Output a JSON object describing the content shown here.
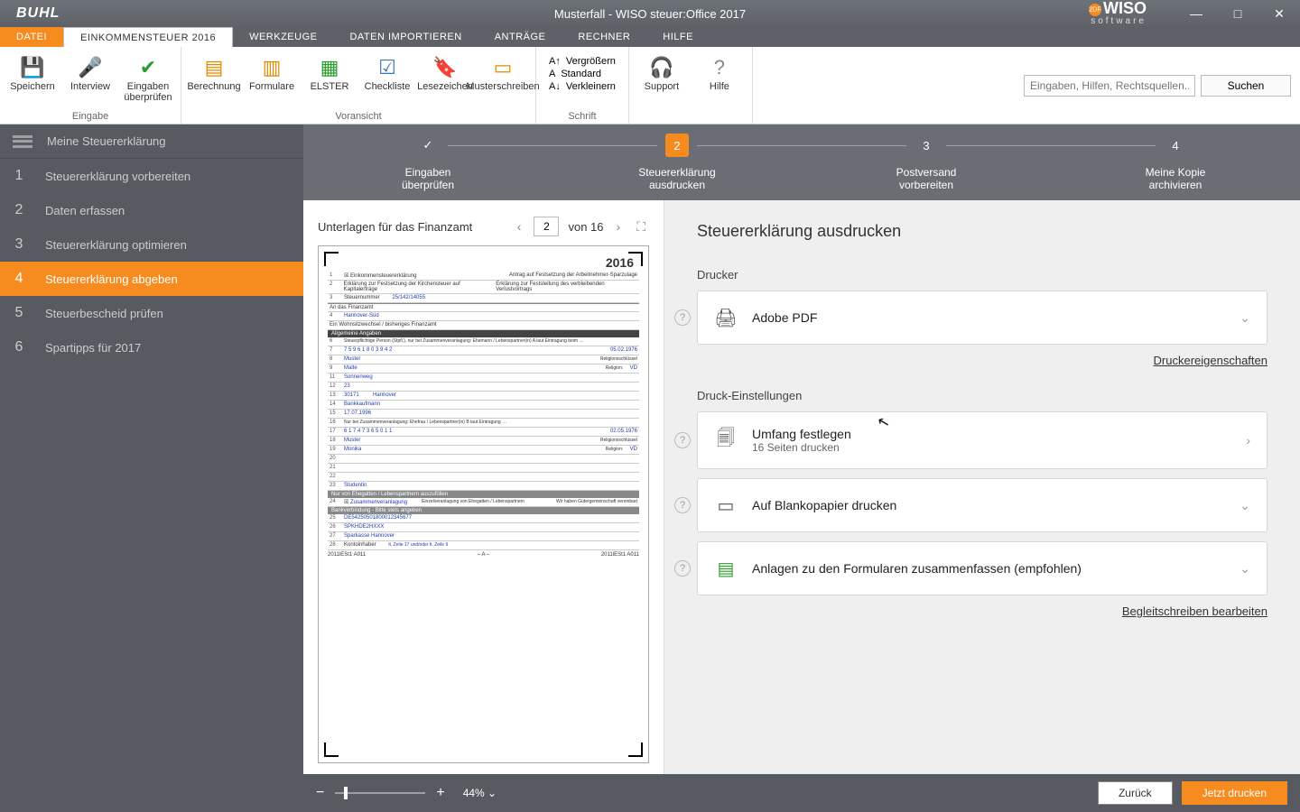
{
  "app": {
    "vendor": "BUHL",
    "title": "Musterfall - WISO steuer:Office 2017",
    "brand_top": "WISO",
    "brand_bottom": "software"
  },
  "menutabs": {
    "file": "DATEI",
    "active": "EINKOMMENSTEUER 2016",
    "items": [
      "WERKZEUGE",
      "DATEN IMPORTIEREN",
      "ANTRÄGE",
      "RECHNER",
      "HILFE"
    ]
  },
  "ribbon": {
    "eingabe": {
      "cap": "Eingabe",
      "speichern": "Speichern",
      "interview": "Interview",
      "eingaben": "Eingaben überprüfen"
    },
    "voransicht": {
      "cap": "Voransicht",
      "berechnung": "Berechnung",
      "formulare": "Formulare",
      "elster": "ELSTER",
      "checkliste": "Checkliste",
      "lesezeichen": "Lesezeichen",
      "muster": "Musterschreiben"
    },
    "schrift": {
      "cap": "Schrift",
      "vergroessern": "Vergrößern",
      "standard": "Standard",
      "verkleinern": "Verkleinern"
    },
    "support": "Support",
    "hilfe": "Hilfe",
    "search": {
      "placeholder": "Eingaben, Hilfen, Rechtsquellen...",
      "button": "Suchen"
    }
  },
  "sidebar": {
    "head": "Meine Steuererklärung",
    "items": [
      {
        "n": "1",
        "t": "Steuererklärung vorbereiten"
      },
      {
        "n": "2",
        "t": "Daten erfassen"
      },
      {
        "n": "3",
        "t": "Steuererklärung optimieren"
      },
      {
        "n": "4",
        "t": "Steuererklärung abgeben"
      },
      {
        "n": "5",
        "t": "Steuerbescheid prüfen"
      },
      {
        "n": "6",
        "t": "Spartipps für 2017"
      }
    ],
    "active_index": 3
  },
  "wizard": [
    {
      "badge": "✓",
      "l1": "Eingaben",
      "l2": "überprüfen"
    },
    {
      "badge": "2",
      "l1": "Steuererklärung",
      "l2": "ausdrucken"
    },
    {
      "badge": "3",
      "l1": "Postversand",
      "l2": "vorbereiten"
    },
    {
      "badge": "4",
      "l1": "Meine Kopie",
      "l2": "archivieren"
    }
  ],
  "wizard_active": 1,
  "preview": {
    "title": "Unterlagen für das Finanzamt",
    "page": "2",
    "of_prefix": "von ",
    "of_total": "16",
    "year": "2016",
    "barcodes": [
      "2011lESt1 A011",
      "2011lESt1 A011"
    ],
    "toprow": [
      "Einkommensteuererklärung",
      "Antrag auf Festsetzung der Arbeitnehmer-Sparzulage"
    ],
    "toprow2": [
      "Erklärung zur Festsetzung der Kirchensteuer auf Kapitalerträge",
      "Erklärung zur Feststellung des verbleibenden Verlustvortrags"
    ],
    "steuernr_lbl": "Steuernummer",
    "steuernr": "25/142/14055",
    "fa_lbl": "An das Finanzamt",
    "fa": "Hannover-Süd",
    "wohnsitz": "Ein Wohnsitzwechsel / bisheriges Finanzamt",
    "allg": "Allgemeine Angaben",
    "idnr": "7 5 9 6 1 8 0 3 9 4 2",
    "geb1": "05.02.1976",
    "name1": "Muster",
    "vorname1": "Malte",
    "rel": "Religionsschlüssel",
    "street": "Sonnenweg",
    "hausnr": "23",
    "plz": "30171",
    "ort": "Hannover",
    "beruf1": "Bankkaufmann",
    "heirat": "17.07.1996",
    "idnr2": "6 1 7 4 7 3 6 5 0 1 1",
    "geb2": "02.05.1976",
    "name2": "Muster",
    "vorname2": "Monika",
    "beruf2": "Studentin",
    "zusammen": "Zusammenveranlagung",
    "ehegatten": "Nur von Ehegatten / Lebenspartnern auszufüllen",
    "bankhead": "Bankverbindung - Bitte stets angeben",
    "iban": "DE54250501800012345677",
    "bic": "SPKHDE2HXXX",
    "bank": "Sparkasse Hannover",
    "kontoinhaber_lbl": "Kontoinhaber",
    "kontoinhaber": "lt. Zeile 17 und/oder lt. Zeile 9"
  },
  "settings": {
    "heading": "Steuererklärung ausdrucken",
    "printer_lbl": "Drucker",
    "printer": "Adobe PDF",
    "printer_props": "Druckereigenschaften",
    "print_lbl": "Druck-Einstellungen",
    "umfang_t": "Umfang festlegen",
    "umfang_s": "16 Seiten drucken",
    "blanko": "Auf Blankopapier drucken",
    "anlagen": "Anlagen zu den Formularen zusammenfassen (empfohlen)",
    "begleit": "Begleitschreiben bearbeiten"
  },
  "footer": {
    "zoom": "44%",
    "back": "Zurück",
    "print": "Jetzt drucken"
  }
}
